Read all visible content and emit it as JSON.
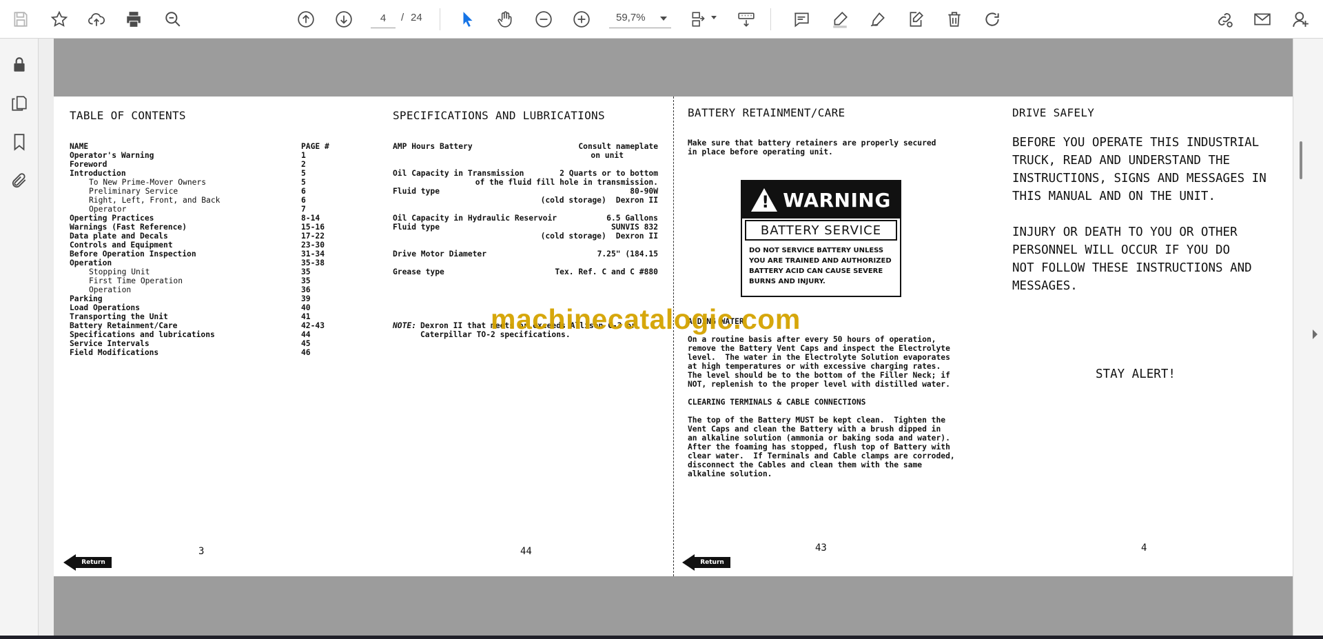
{
  "toolbar": {
    "current_page": "4",
    "page_separator": "/",
    "total_pages": "24",
    "zoom": "59,7%"
  },
  "document": {
    "left_spread": {
      "toc": {
        "heading": "TABLE OF CONTENTS",
        "col_name": "NAME",
        "col_page": "PAGE #",
        "rows": [
          {
            "name": "Operator's Warning",
            "page": "1",
            "indent": false
          },
          {
            "name": "Foreword",
            "page": "2",
            "indent": false
          },
          {
            "name": "Introduction",
            "page": "5",
            "indent": false
          },
          {
            "name": "To New Prime-Mover Owners",
            "page": "5",
            "indent": true
          },
          {
            "name": "Preliminary Service",
            "page": "6",
            "indent": true
          },
          {
            "name": "Right, Left, Front, and Back",
            "page": "6",
            "indent": true
          },
          {
            "name": "Operator",
            "page": "7",
            "indent": true
          },
          {
            "name": "Operting Practices",
            "page": "8-14",
            "indent": false
          },
          {
            "name": "Warnings (Fast Reference)",
            "page": "15-16",
            "indent": false
          },
          {
            "name": "Data plate and Decals",
            "page": "17-22",
            "indent": false
          },
          {
            "name": "Controls and Equipment",
            "page": "23-30",
            "indent": false
          },
          {
            "name": "Before Operation Inspection",
            "page": "31-34",
            "indent": false
          },
          {
            "name": "Operation",
            "page": "35-38",
            "indent": false
          },
          {
            "name": "Stopping Unit",
            "page": "35",
            "indent": true
          },
          {
            "name": "First Time Operation",
            "page": "35",
            "indent": true
          },
          {
            "name": "Operation",
            "page": "36",
            "indent": true
          },
          {
            "name": "Parking",
            "page": "39",
            "indent": false
          },
          {
            "name": "Load Operations",
            "page": "40",
            "indent": false
          },
          {
            "name": "Transporting the Unit",
            "page": "41",
            "indent": false
          },
          {
            "name": "Battery Retainment/Care",
            "page": "42-43",
            "indent": false
          },
          {
            "name": "Specifications and lubrications",
            "page": "44",
            "indent": false
          },
          {
            "name": "Service Intervals",
            "page": "45",
            "indent": false
          },
          {
            "name": "Field Modifications",
            "page": "46",
            "indent": false
          }
        ],
        "page_number": "3"
      },
      "specs": {
        "heading": "SPECIFICATIONS AND LUBRICATIONS",
        "amp_label": "AMP Hours Battery",
        "amp_value1": "Consult nameplate",
        "amp_value2": "on unit",
        "oil_trans_label": "Oil Capacity in Transmission",
        "oil_trans_value1": "2 Quarts or to bottom",
        "oil_trans_value2": "of the fluid fill hole in transmission.",
        "fluid1_label": "Fluid type",
        "fluid1_value": "80-90W",
        "fluid1_cold_label": "(cold storage)",
        "fluid1_cold_value": "Dexron II",
        "oil_hyd_label": "Oil Capacity in Hydraulic Reservoir",
        "oil_hyd_value": "6.5 Gallons",
        "fluid2_label": "Fluid type",
        "fluid2_value": "SUNVIS 832",
        "fluid2_cold_label": "(cold storage)",
        "fluid2_cold_value": "Dexron II",
        "motor_label": "Drive Motor Diameter",
        "motor_value": "7.25\"  (184.15",
        "grease_label": "Grease type",
        "grease_value": "Tex. Ref. C and C #880",
        "note_label": "NOTE:",
        "note_line1": "Dexron II that meets or exceeds Allison C-3 or",
        "note_line2": "Caterpillar TO-2 specifications.",
        "page_number": "44"
      },
      "return_label": "Return"
    },
    "right_spread": {
      "battery": {
        "heading": "BATTERY RETAINMENT/CARE",
        "intro_line1": "Make sure that battery retainers are properly secured",
        "intro_line2": "in place before operating unit.",
        "sign_title": "WARNING",
        "sign_subtitle": "BATTERY SERVICE",
        "sign_text": "DO NOT SERVICE BATTERY UNLESS\nYOU ARE TRAINED AND AUTHORIZED\nBATTERY ACID CAN CAUSE SEVERE\nBURNS AND INJURY.",
        "adding_heading": "ADDING WATER",
        "adding_text": "On a routine basis after every 50 hours of operation,\nremove the Battery Vent Caps and inspect the Electrolyte\nlevel.  The water in the Electrolyte Solution evaporates\nat high temperatures or with excessive charging rates.\nThe level should be to the bottom of the Filler Neck; if\nNOT, replenish to the proper level with distilled water.",
        "clearing_heading": "CLEARING TERMINALS & CABLE CONNECTIONS",
        "clearing_text": "The top of the Battery MUST be kept clean.  Tighten the\nVent Caps and clean the Battery with a brush dipped in\nan alkaline solution (ammonia or baking soda and water).\nAfter the foaming has stopped, flush top of Battery with\nclear water.  If Terminals and Cable clamps are corroded,\ndisconnect the Cables and clean them with the same\nalkaline solution.",
        "page_number": "43"
      },
      "drive": {
        "heading": "DRIVE SAFELY",
        "para1": "BEFORE YOU OPERATE THIS INDUSTRIAL\nTRUCK, READ AND UNDERSTAND THE\nINSTRUCTIONS, SIGNS AND MESSAGES IN\nTHIS MANUAL AND ON THE UNIT.",
        "para2": "INJURY OR DEATH TO YOU OR OTHER\nPERSONNEL WILL OCCUR IF YOU DO\nNOT FOLLOW THESE INSTRUCTIONS AND\nMESSAGES.",
        "alert": "STAY ALERT!",
        "page_number": "4"
      },
      "return_label": "Return"
    },
    "watermark": "machinecatalogic.com"
  }
}
